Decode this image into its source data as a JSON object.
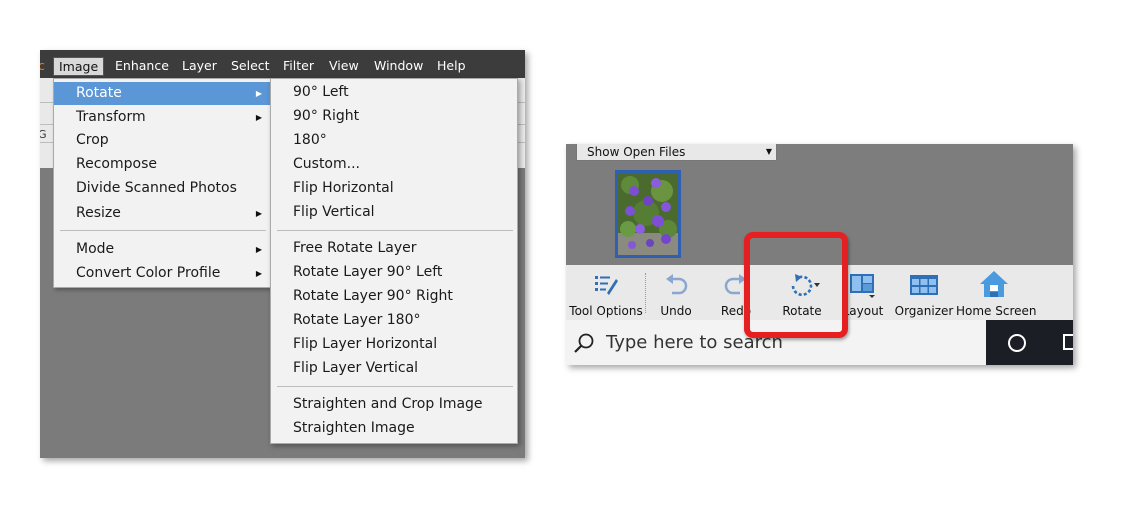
{
  "left_panel": {
    "menubar": {
      "items": [
        "c",
        "Image",
        "Enhance",
        "Layer",
        "Select",
        "Filter",
        "View",
        "Window",
        "Help"
      ],
      "active": "Image"
    },
    "image_menu": {
      "items": [
        {
          "label": "Rotate",
          "submenu": true,
          "selected": true
        },
        {
          "label": "Transform",
          "submenu": true
        },
        {
          "label": "Crop"
        },
        {
          "label": "Recompose"
        },
        {
          "label": "Divide Scanned Photos"
        },
        {
          "label": "Resize",
          "submenu": true
        },
        {
          "label": "Mode",
          "submenu": true
        },
        {
          "label": "Convert Color Profile",
          "submenu": true
        }
      ]
    },
    "rotate_submenu": {
      "items": [
        "90° Left",
        "90° Right",
        "180°",
        "Custom...",
        "Flip Horizontal",
        "Flip Vertical",
        "Free Rotate Layer",
        "Rotate Layer 90° Left",
        "Rotate Layer 90° Right",
        "Rotate Layer 180°",
        "Flip Layer Horizontal",
        "Flip Layer Vertical",
        "Straighten and Crop Image",
        "Straighten Image"
      ]
    },
    "toolbar_fragment": "G"
  },
  "right_panel": {
    "show_open_files": "Show Open Files",
    "taskbar": {
      "tool_options": "Tool Options",
      "undo": "Undo",
      "redo": "Redo",
      "rotate": "Rotate",
      "layout": "Layout",
      "organizer": "Organizer",
      "home_screen": "Home Screen"
    },
    "search_placeholder": "Type here to search",
    "icons": {
      "tool_options": "tool-options-icon",
      "undo": "undo-icon",
      "redo": "redo-icon",
      "rotate": "rotate-icon",
      "layout": "layout-icon",
      "organizer": "organizer-icon",
      "home_screen": "home-icon",
      "search": "search-icon",
      "cortana": "cortana-icon",
      "task_view": "task-view-icon"
    }
  },
  "colors": {
    "menu_selected": "#5b97d6",
    "highlight": "#e62020",
    "icon_blue": "#2e6fb5"
  }
}
